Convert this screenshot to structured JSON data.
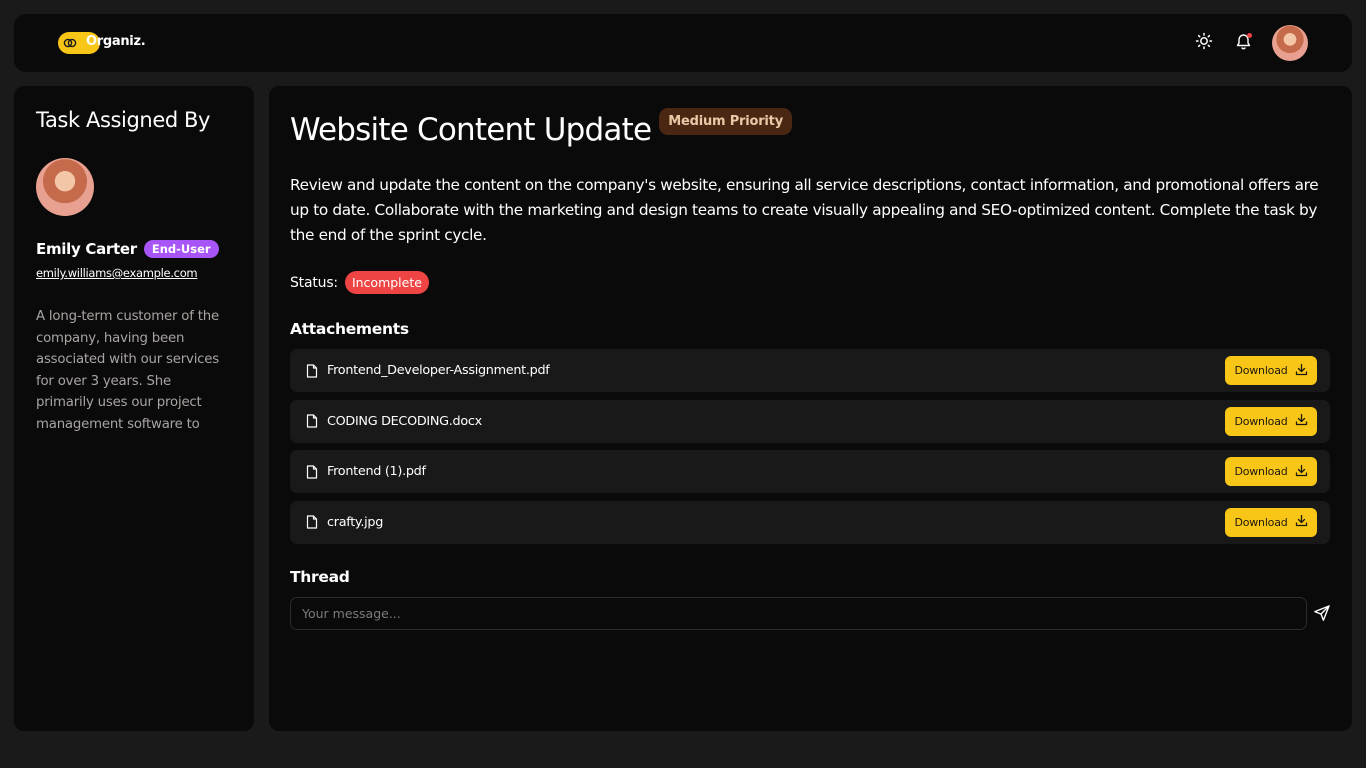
{
  "app": {
    "logo_text": "Organiz.",
    "brand_color": "#f8c617"
  },
  "header": {
    "icons": [
      "sun-icon",
      "bell-icon"
    ],
    "notification_dot_color": "#ef4444"
  },
  "sidebar": {
    "title": "Task Assigned By",
    "user": {
      "name": "Emily Carter",
      "role": "End-User",
      "email": "emily.williams@example.com",
      "description": "A long-term customer of the company, having been associated with our services for over 3 years. She primarily uses our project management software to manage her tea..."
    },
    "role_badge_color": "#a855f7"
  },
  "task": {
    "title": "Website Content Update",
    "priority": "Medium Priority",
    "description": "Review and update the content on the company's website, ensuring all service descriptions, contact information, and promotional offers are up to date. Collaborate with the marketing and design teams to create visually appealing and SEO-optimized content. Complete the task by the end of the sprint cycle.",
    "status_label": "Status:",
    "status": "Incomplete",
    "status_color": "#ef4444"
  },
  "attachments": {
    "heading": "Attachements",
    "download_label": "Download",
    "files": [
      {
        "name": "Frontend_Developer-Assignment.pdf"
      },
      {
        "name": "CODING DECODING.docx"
      },
      {
        "name": "Frontend (1).pdf"
      },
      {
        "name": "crafty.jpg"
      }
    ]
  },
  "thread": {
    "heading": "Thread",
    "placeholder": "Your message..."
  }
}
